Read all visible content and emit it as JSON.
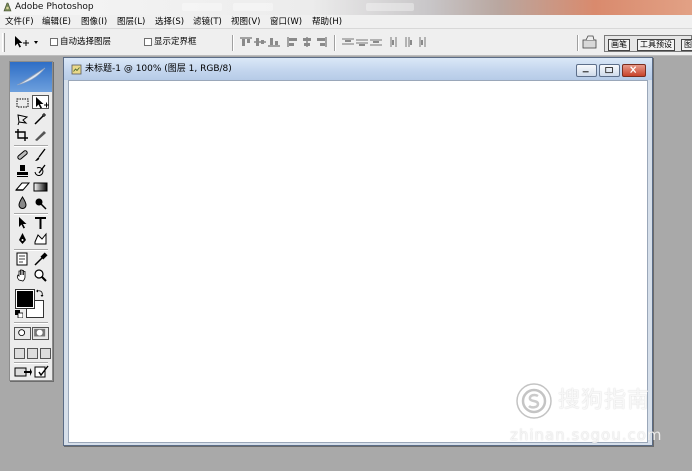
{
  "window": {
    "title": "Adobe Photoshop"
  },
  "menu": {
    "items": [
      "文件(F)",
      "编辑(E)",
      "图像(I)",
      "图层(L)",
      "选择(S)",
      "滤镜(T)",
      "视图(V)",
      "窗口(W)",
      "帮助(H)"
    ]
  },
  "options_bar": {
    "auto_select_layer": {
      "label": "自动选择图层",
      "checked": false
    },
    "show_bounding_box": {
      "label": "显示定界框",
      "checked": false
    }
  },
  "palette_well": {
    "tabs": [
      "画笔",
      "工具预设",
      "图"
    ]
  },
  "document": {
    "title": "未标题-1 @ 100% (图层 1, RGB/8)"
  },
  "colors": {
    "foreground": "#000000",
    "background": "#ffffff",
    "toolbox_header": "#3b78c9"
  },
  "watermark": {
    "name": "搜狗指南",
    "url": "zhinan.sogou.com"
  }
}
